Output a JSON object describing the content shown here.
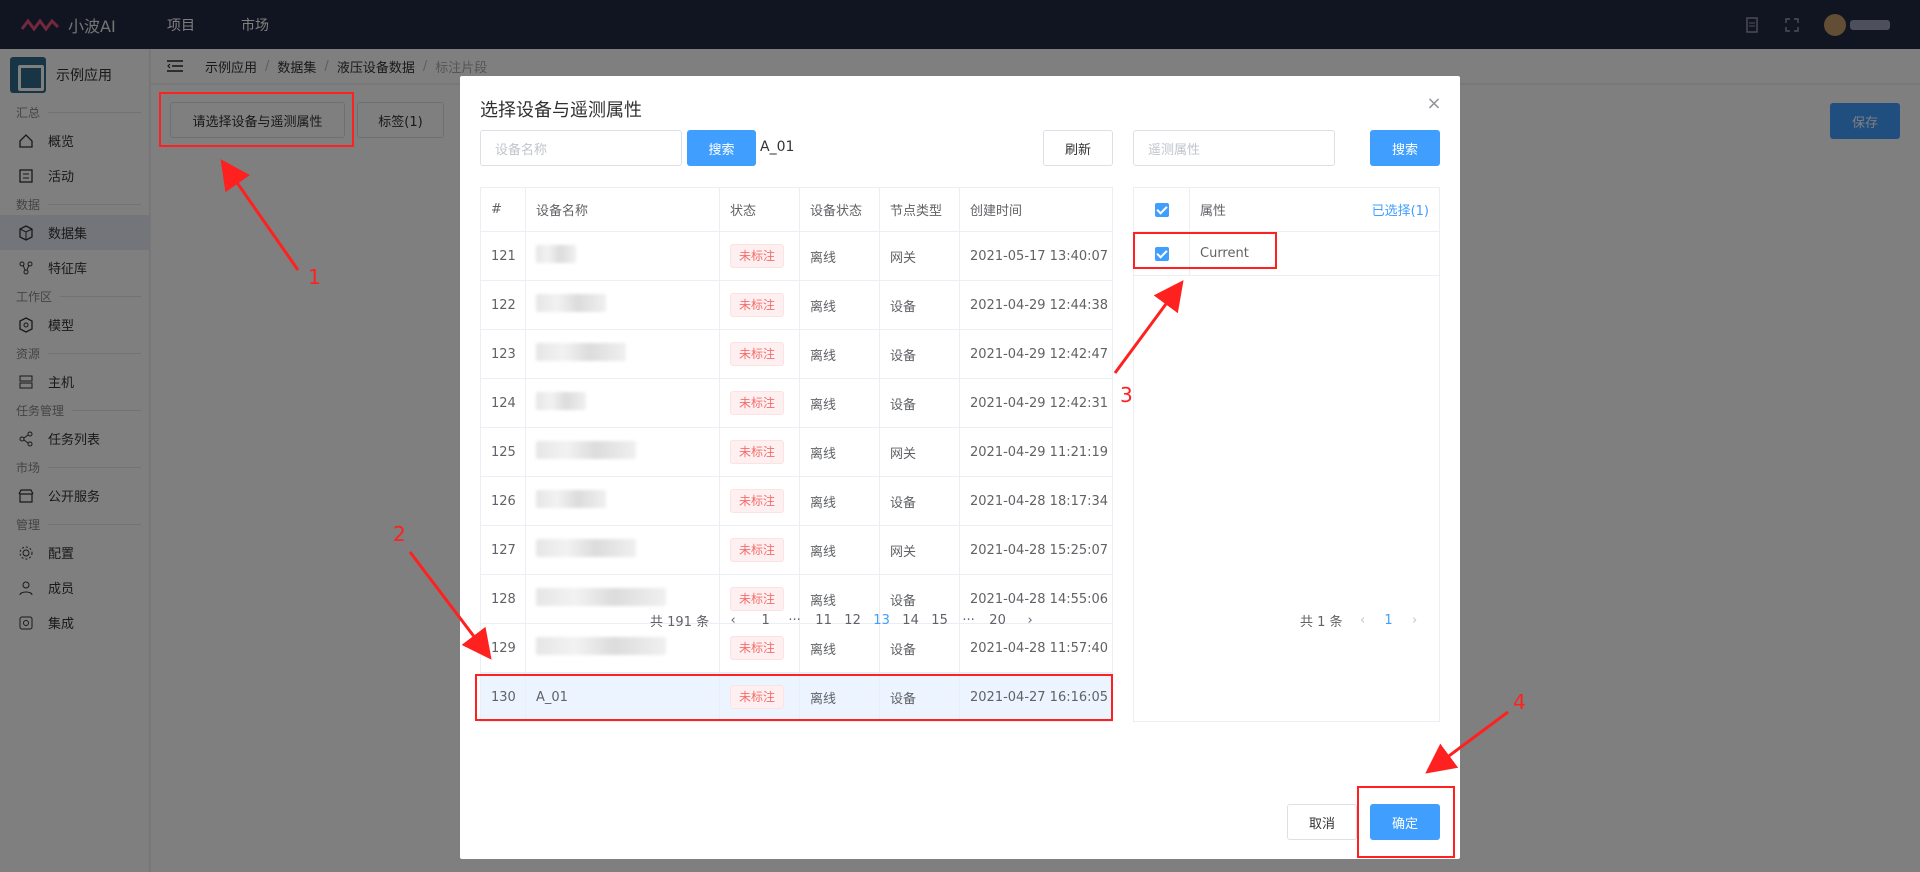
{
  "topbar": {
    "brand": "小波AI",
    "nav": [
      "项目",
      "市场"
    ]
  },
  "sidebar": {
    "app_name": "示例应用",
    "sections": [
      {
        "title": "汇总",
        "items": [
          {
            "label": "概览",
            "icon": "home-icon"
          },
          {
            "label": "活动",
            "icon": "activity-icon"
          }
        ]
      },
      {
        "title": "数据",
        "items": [
          {
            "label": "数据集",
            "icon": "cube-icon",
            "active": true
          },
          {
            "label": "特征库",
            "icon": "network-icon"
          }
        ]
      },
      {
        "title": "工作区",
        "items": [
          {
            "label": "模型",
            "icon": "model-icon"
          }
        ]
      },
      {
        "title": "资源",
        "items": [
          {
            "label": "主机",
            "icon": "server-icon"
          }
        ]
      },
      {
        "title": "任务管理",
        "items": [
          {
            "label": "任务列表",
            "icon": "share-icon"
          }
        ]
      },
      {
        "title": "市场",
        "items": [
          {
            "label": "公开服务",
            "icon": "shop-icon"
          }
        ]
      },
      {
        "title": "管理",
        "items": [
          {
            "label": "配置",
            "icon": "gear-icon"
          },
          {
            "label": "成员",
            "icon": "users-icon"
          },
          {
            "label": "集成",
            "icon": "integration-icon"
          }
        ]
      }
    ]
  },
  "breadcrumb": [
    "示例应用",
    "数据集",
    "液压设备数据",
    "标注片段"
  ],
  "page": {
    "select_btn": "请选择设备与遥测属性",
    "tags_btn": "标签(1)",
    "save_btn": "保存"
  },
  "dialog": {
    "title": "选择设备与遥测属性",
    "device_search_placeholder": "设备名称",
    "search_btn": "搜索",
    "selected_device": "A_01",
    "refresh_btn": "刷新",
    "attr_search_placeholder": "遥测属性",
    "attr_search_btn": "搜索",
    "columns": [
      "#",
      "设备名称",
      "状态",
      "设备状态",
      "节点类型",
      "创建时间"
    ],
    "rows": [
      {
        "id": "121",
        "name": "",
        "status": "未标注",
        "device_status": "离线",
        "node_type": "网关",
        "created": "2021-05-17 13:40:07"
      },
      {
        "id": "122",
        "name": "",
        "status": "未标注",
        "device_status": "离线",
        "node_type": "设备",
        "created": "2021-04-29 12:44:38"
      },
      {
        "id": "123",
        "name": "",
        "status": "未标注",
        "device_status": "离线",
        "node_type": "设备",
        "created": "2021-04-29 12:42:47"
      },
      {
        "id": "124",
        "name": "",
        "status": "未标注",
        "device_status": "离线",
        "node_type": "设备",
        "created": "2021-04-29 12:42:31"
      },
      {
        "id": "125",
        "name": "",
        "status": "未标注",
        "device_status": "离线",
        "node_type": "网关",
        "created": "2021-04-29 11:21:19"
      },
      {
        "id": "126",
        "name": "",
        "status": "未标注",
        "device_status": "离线",
        "node_type": "设备",
        "created": "2021-04-28 18:17:34"
      },
      {
        "id": "127",
        "name": "",
        "status": "未标注",
        "device_status": "离线",
        "node_type": "网关",
        "created": "2021-04-28 15:25:07"
      },
      {
        "id": "128",
        "name": "",
        "status": "未标注",
        "device_status": "离线",
        "node_type": "设备",
        "created": "2021-04-28 14:55:06"
      },
      {
        "id": "129",
        "name": "",
        "status": "未标注",
        "device_status": "离线",
        "node_type": "设备",
        "created": "2021-04-28 11:57:40"
      },
      {
        "id": "130",
        "name": "A_01",
        "status": "未标注",
        "device_status": "离线",
        "node_type": "设备",
        "created": "2021-04-27 16:16:05",
        "selected": true
      }
    ],
    "device_pager": {
      "total": "共 191 条",
      "pages": [
        "1",
        "···",
        "11",
        "12",
        "13",
        "14",
        "15",
        "···",
        "20"
      ],
      "current": "13"
    },
    "attr_columns": {
      "label": "属性",
      "selected_count": "已选择(1)"
    },
    "attrs": [
      {
        "name": "Current",
        "checked": true
      }
    ],
    "attr_pager": {
      "total": "共 1 条",
      "current": "1"
    },
    "cancel_btn": "取消",
    "confirm_btn": "确定"
  },
  "annotations": [
    "1",
    "2",
    "3",
    "4"
  ],
  "colors": {
    "primary": "#409eff",
    "topbar": "#232a44",
    "annotation": "#ff2020",
    "tag_red": "#f56c6c"
  }
}
